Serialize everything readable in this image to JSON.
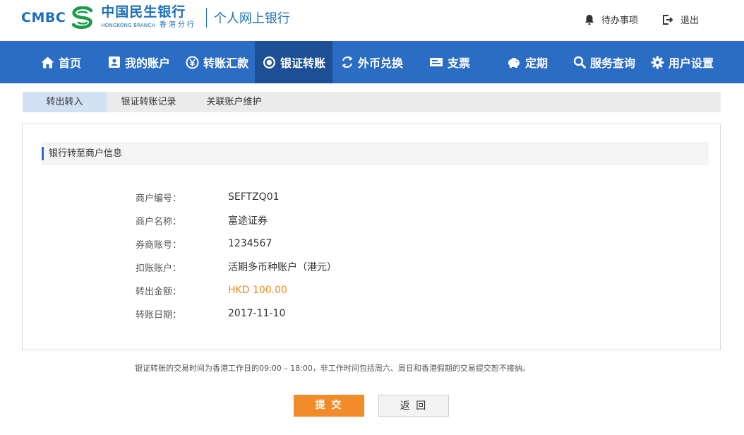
{
  "header": {
    "logo_text": "CMBC",
    "bank_name_cn": "中国民生银行",
    "branch_en": "HONGKONG BRANCH",
    "branch_cn": "香港分行",
    "subtitle": "个人网上银行",
    "pending_label": "待办事项",
    "logout_label": "退出",
    "brand_color": "#1a6fb9"
  },
  "nav": {
    "items": [
      {
        "label": "首页",
        "icon": "home-icon"
      },
      {
        "label": "我的账户",
        "icon": "account-book-icon"
      },
      {
        "label": "转账汇款",
        "icon": "yen-circle-icon"
      },
      {
        "label": "银证转账",
        "icon": "target-circle-icon",
        "active": true
      },
      {
        "label": "外币兑换",
        "icon": "exchange-cycle-icon"
      },
      {
        "label": "支票",
        "icon": "cheque-icon"
      },
      {
        "label": "定期",
        "icon": "piggy-bank-icon"
      },
      {
        "label": "服务查询",
        "icon": "search-icon"
      },
      {
        "label": "用户设置",
        "icon": "gear-icon"
      }
    ],
    "bg_color": "#2b6cc4",
    "active_color": "#1c4f93"
  },
  "subtabs": {
    "items": [
      {
        "label": "转出转入",
        "active": true
      },
      {
        "label": "银证转账记录"
      },
      {
        "label": "关联账户维护"
      }
    ]
  },
  "panel": {
    "section_title": "银行转至商户信息",
    "fields": [
      {
        "label": "商户编号：",
        "value": "SEFTZQ01"
      },
      {
        "label": "商户名称：",
        "value": "富途证券"
      },
      {
        "label": "券商账号：",
        "value": "1234567"
      },
      {
        "label": "扣账账户：",
        "value": "活期多币种账户（港元）"
      },
      {
        "label": "转出金额：",
        "value": "HKD 100.00"
      },
      {
        "label": "转账日期：",
        "value": "2017-11-10"
      }
    ],
    "amount_color": "#f08a1c"
  },
  "notice": "银证转账的交易时间为香港工作日的09:00 – 18:00，非工作时间包括周六、周日和香港假期的交易提交恕不接纳。",
  "buttons": {
    "submit_label": "提 交",
    "back_label": "返 回"
  }
}
